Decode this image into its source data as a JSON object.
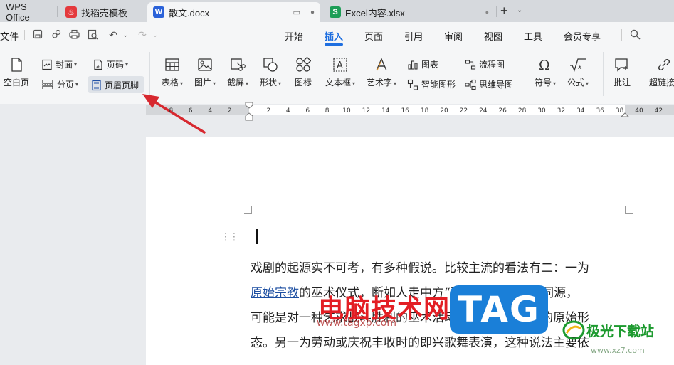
{
  "tabs": [
    {
      "label": "WPS Office"
    },
    {
      "label": "找稻壳模板",
      "icon": "daoke-icon"
    },
    {
      "label": "散文.docx",
      "icon": "W"
    },
    {
      "label": "Excel内容.xlsx",
      "icon": "S"
    }
  ],
  "menu": {
    "file": "文件",
    "items": [
      "开始",
      "插入",
      "页面",
      "引用",
      "审阅",
      "视图",
      "工具",
      "会员专享"
    ],
    "active": "插入"
  },
  "ribbon": {
    "blank_page": "空白页",
    "cover": "封面",
    "page_break": "分页",
    "page_number": "页码",
    "header_footer": "页眉页脚",
    "table": "表格",
    "picture": "图片",
    "screenshot": "截屏",
    "shape": "形状",
    "icon": "图标",
    "textbox": "文本框",
    "wordart": "艺术字",
    "chart": "图表",
    "smartart": "智能图形",
    "flowchart": "流程图",
    "mindmap": "思维导图",
    "symbol": "符号",
    "formula": "公式",
    "comment": "批注",
    "hyperlink": "超链接"
  },
  "ruler": {
    "ticks_left": [
      "8",
      "6",
      "4",
      "2"
    ],
    "ticks_right": [
      "2",
      "4",
      "6",
      "8",
      "10",
      "12",
      "14",
      "16",
      "18",
      "20",
      "22",
      "24",
      "26",
      "28",
      "30",
      "32",
      "34",
      "36",
      "38",
      "40",
      "42"
    ]
  },
  "document": {
    "line1": "戏剧的起源实不可考，有多种假说。比较主流的看法有二：一为",
    "line2_link": "原始宗教",
    "line2_rest": "的巫术仪式，断如人走中方“巫”“舞”“武”三字同源，",
    "line3": "可能是对一种乞求战斗胜利的巫术活动的总称，即戏剧的原始形",
    "line4": "态。另一为劳动或庆祝丰收时的即兴歌舞表演，这种说法主要依"
  },
  "watermark": {
    "site_name": "电脑技术网",
    "site_url": "www.tagxp.com",
    "logo": "TAG",
    "logo2_name": "极光下载站",
    "logo2_url": "www.xz7.com"
  },
  "colors": {
    "accent": "#1f6fe0",
    "arrow": "#d7282f"
  }
}
